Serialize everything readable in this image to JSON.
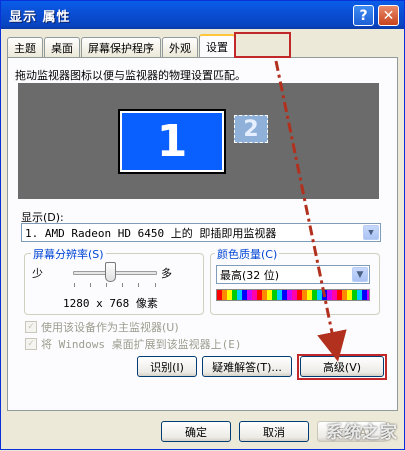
{
  "window": {
    "title": "显示 属性"
  },
  "titlebar": {
    "help_glyph": "?",
    "close_glyph": "✕"
  },
  "tabs": [
    {
      "label": "主题"
    },
    {
      "label": "桌面"
    },
    {
      "label": "屏幕保护程序"
    },
    {
      "label": "外观"
    },
    {
      "label": "设置",
      "active": true
    }
  ],
  "settings": {
    "instruction": "拖动监视器图标以便与监视器的物理设置匹配。",
    "monitor1_label": "1",
    "monitor2_label": "2",
    "display_label": "显示(D):",
    "display_value": "1. AMD Radeon HD 6450 上的 即插即用监视器",
    "resolution": {
      "title": "屏幕分辨率(S)",
      "min_label": "少",
      "max_label": "多",
      "value_text": "1280 x 768 像素"
    },
    "color": {
      "title": "颜色质量(C)",
      "value": "最高(32 位)"
    },
    "checkbox_primary": "使用该设备作为主监视器(U)",
    "checkbox_extend": "将 Windows 桌面扩展到该监视器上(E)",
    "buttons": {
      "identify": "识别(I)",
      "troubleshoot": "疑难解答(T)...",
      "advanced": "高级(V)"
    }
  },
  "dialog_buttons": {
    "ok": "确定",
    "cancel": "取消",
    "apply": "应用(A)"
  },
  "watermark": "系统之家",
  "colors": {
    "titlebar": "#0a4fd6",
    "highlight": "#c0282a",
    "monitor_primary": "#0a5fff"
  }
}
